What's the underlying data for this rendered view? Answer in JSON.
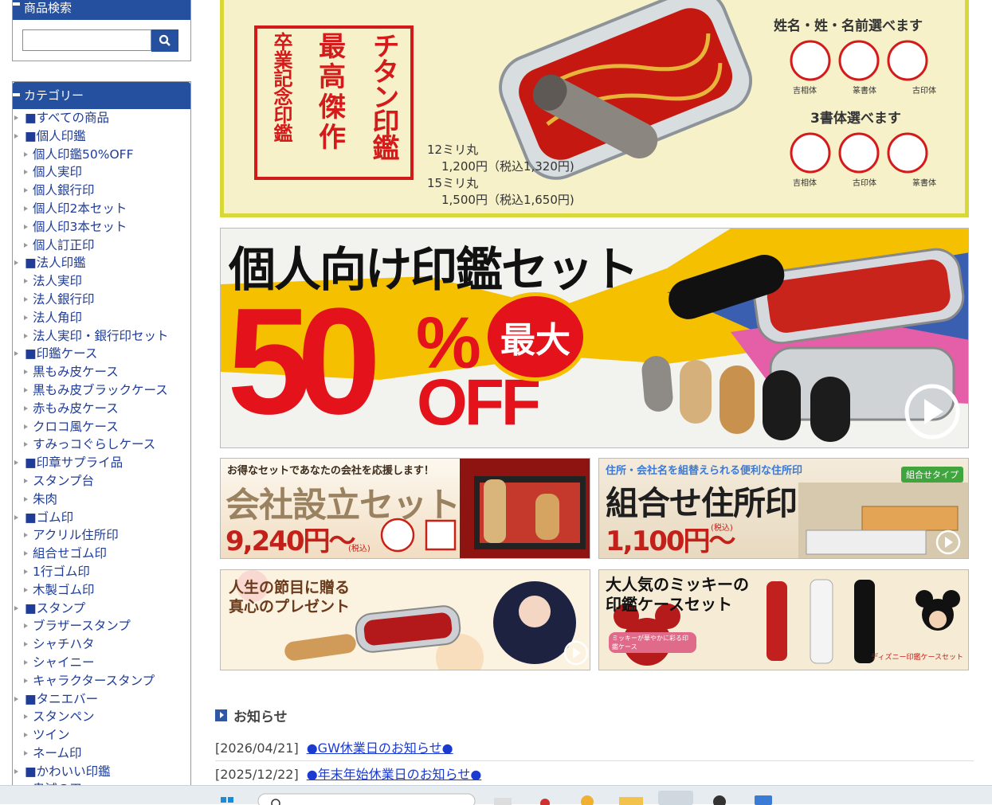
{
  "sidebar": {
    "search_title": "商品検索",
    "search_value": "",
    "category_title": "カテゴリー",
    "categories": [
      {
        "label": "■すべての商品",
        "level": 0
      },
      {
        "label": "■個人印鑑",
        "level": 0
      },
      {
        "label": "個人印鑑50%OFF",
        "level": 1
      },
      {
        "label": "個人実印",
        "level": 1
      },
      {
        "label": "個人銀行印",
        "level": 1
      },
      {
        "label": "個人印2本セット",
        "level": 1
      },
      {
        "label": "個人印3本セット",
        "level": 1
      },
      {
        "label": "個人訂正印",
        "level": 1
      },
      {
        "label": "■法人印鑑",
        "level": 0
      },
      {
        "label": "法人実印",
        "level": 1
      },
      {
        "label": "法人銀行印",
        "level": 1
      },
      {
        "label": "法人角印",
        "level": 1
      },
      {
        "label": "法人実印・銀行印セット",
        "level": 1
      },
      {
        "label": "■印鑑ケース",
        "level": 0
      },
      {
        "label": "黒もみ皮ケース",
        "level": 1
      },
      {
        "label": "黒もみ皮ブラックケース",
        "level": 1
      },
      {
        "label": "赤もみ皮ケース",
        "level": 1
      },
      {
        "label": "クロコ風ケース",
        "level": 1
      },
      {
        "label": "すみっコぐらしケース",
        "level": 1
      },
      {
        "label": "■印章サプライ品",
        "level": 0
      },
      {
        "label": "スタンプ台",
        "level": 1
      },
      {
        "label": "朱肉",
        "level": 1
      },
      {
        "label": "■ゴム印",
        "level": 0
      },
      {
        "label": "アクリル住所印",
        "level": 1
      },
      {
        "label": "組合せゴム印",
        "level": 1
      },
      {
        "label": "1行ゴム印",
        "level": 1
      },
      {
        "label": "木製ゴム印",
        "level": 1
      },
      {
        "label": "■スタンプ",
        "level": 0
      },
      {
        "label": "ブラザースタンプ",
        "level": 1
      },
      {
        "label": "シャチハタ",
        "level": 1
      },
      {
        "label": "シャイニー",
        "level": 1
      },
      {
        "label": "キャラクタースタンプ",
        "level": 1
      },
      {
        "label": "■タニエバー",
        "level": 0
      },
      {
        "label": "スタンペン",
        "level": 1
      },
      {
        "label": "ツイン",
        "level": 1
      },
      {
        "label": "ネーム印",
        "level": 1
      },
      {
        "label": "■かわいい印鑑",
        "level": 0
      },
      {
        "label": "鬼滅の刃",
        "level": 1
      }
    ]
  },
  "banner1": {
    "vertical_cols": [
      "チタン印鑑",
      "最高傑作",
      "卒業記念印鑑"
    ],
    "names_title": "姓名・姓・名前選べます",
    "fonts_title": "3書体選べます",
    "seal_labels_top": [
      "吉相体",
      "篆書体",
      "古印体"
    ],
    "seal_labels_bottom": [
      "吉相体",
      "古印体",
      "篆書体"
    ],
    "price_line1": "12ミリ丸",
    "price_line2": "1,200円（税込1,320円)",
    "price_line3": "15ミリ丸",
    "price_line4": "1,500円（税込1,650円)"
  },
  "banner2": {
    "headline": "個人向け印鑑セット",
    "big_number": "50",
    "percent": "%",
    "off": "OFF",
    "max": "最大"
  },
  "banner3": {
    "tagline": "お得なセットであなたの会社を応援します！",
    "title": "会社設立セット",
    "price": "9,240円〜",
    "tax": "(税込)"
  },
  "banner4": {
    "tagline": "住所・会社名を組替えられる便利な住所印",
    "title": "組合せ住所印",
    "price": "1,100円〜",
    "tax": "(税込)",
    "badge": "組合せタイプ"
  },
  "banner5": {
    "line1": "人生の節目に贈る",
    "line2": "真心のプレゼント"
  },
  "banner6": {
    "line1": "大人気のミッキーの",
    "line2": "印鑑ケースセット",
    "sub": "ミッキーが華やかに彩る印鑑ケース",
    "footer": "ディズニー印鑑ケースセット"
  },
  "news": {
    "title": "お知らせ",
    "items": [
      {
        "date": "[2026/04/21]",
        "text": "●GW休業日のお知らせ●"
      },
      {
        "date": "[2025/12/22]",
        "text": "●年末年始休業日のお知らせ●"
      }
    ]
  },
  "colors": {
    "sidebar_head": "#254f9f",
    "link": "#1e3c98",
    "banner_red": "#e3121b",
    "banner_yellow": "#f5d400"
  }
}
